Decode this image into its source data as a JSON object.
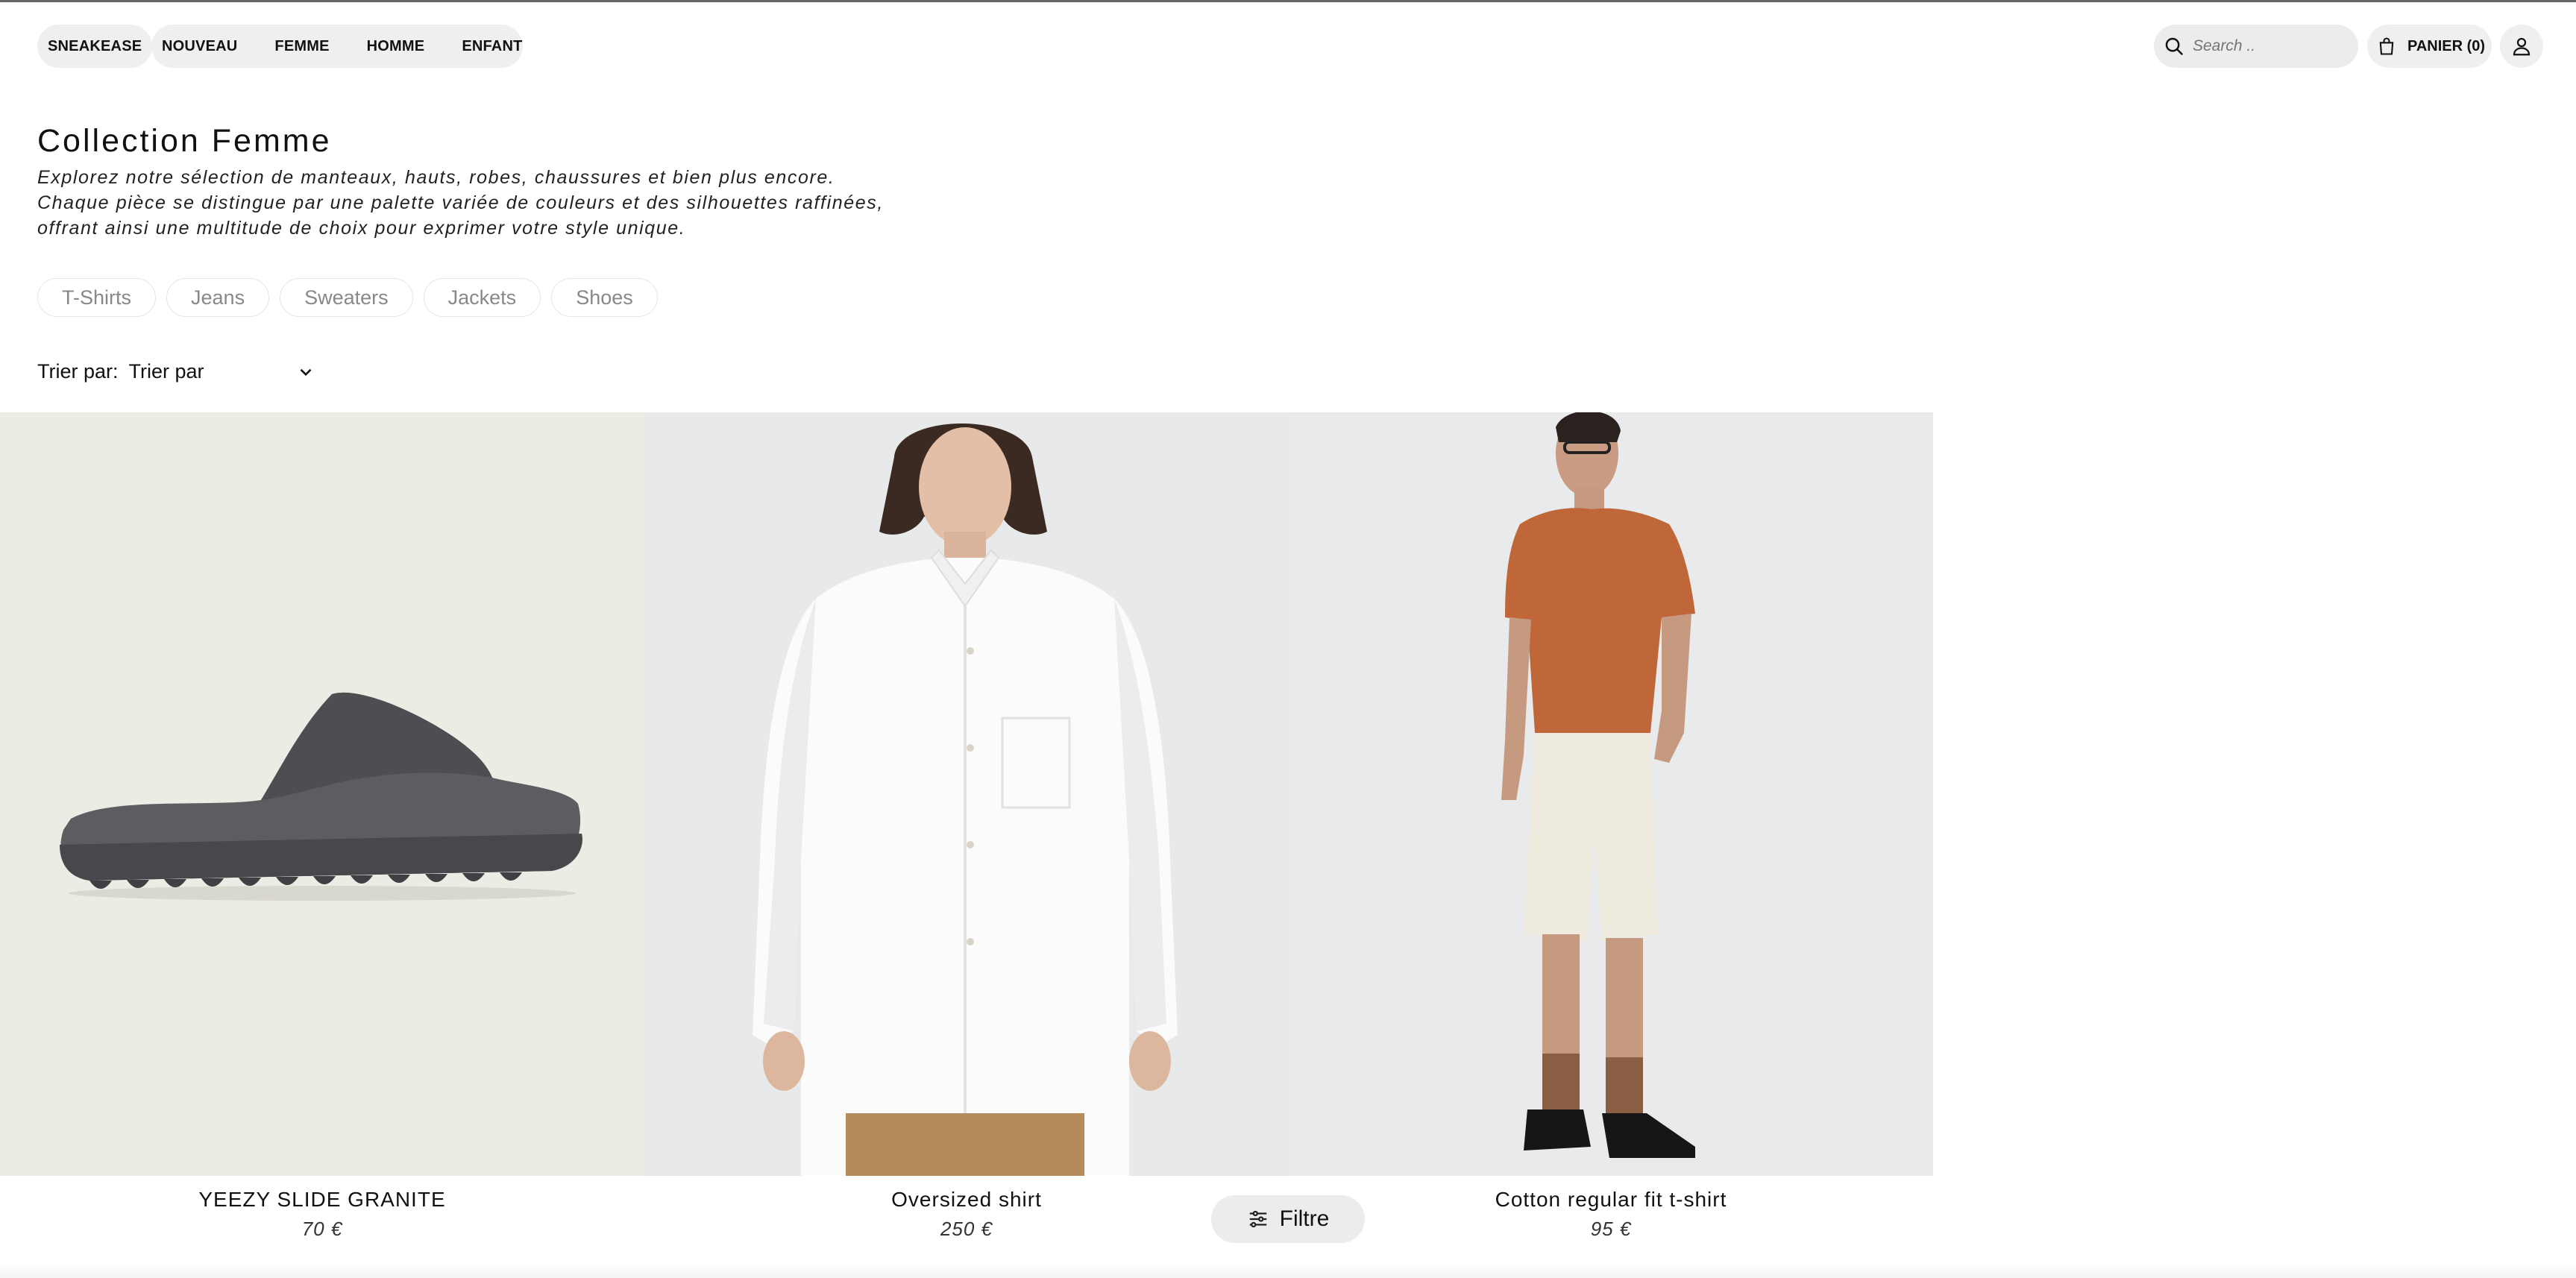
{
  "header": {
    "brand": "SNEAKEASE",
    "nav": [
      "NOUVEAU",
      "FEMME",
      "HOMME",
      "ENFANT"
    ],
    "search_placeholder": "Search ..",
    "cart_label": "PANIER (0)",
    "icons": {
      "search": "search-icon",
      "cart": "shopping-bag-icon",
      "account": "user-icon"
    }
  },
  "intro": {
    "title": "Collection Femme",
    "description_lines": [
      "Explorez notre sélection de manteaux, hauts, robes, chaussures et bien plus encore.",
      "Chaque pièce se distingue par une palette variée de couleurs et des silhouettes raffinées,",
      "offrant ainsi une multitude de choix pour exprimer votre style unique."
    ]
  },
  "categories": [
    "T-Shirts",
    "Jeans",
    "Sweaters",
    "Jackets",
    "Shoes"
  ],
  "sort": {
    "label": "Trier par:",
    "selected": "Trier par"
  },
  "products": [
    {
      "name": "YEEZY SLIDE GRANITE",
      "price": "70 €",
      "image": "grey-slide-sandal",
      "bg": "#ecebe4"
    },
    {
      "name": "Oversized shirt",
      "price": "250 €",
      "image": "woman-white-oversized-shirt",
      "bg": "#e8e9eb"
    },
    {
      "name": "Cotton regular fit t-shirt",
      "price": "95 €",
      "image": "man-orange-tshirt-white-shorts",
      "bg": "#e9eaec"
    }
  ],
  "filter_button": {
    "label": "Filtre",
    "icon": "sliders-icon"
  }
}
